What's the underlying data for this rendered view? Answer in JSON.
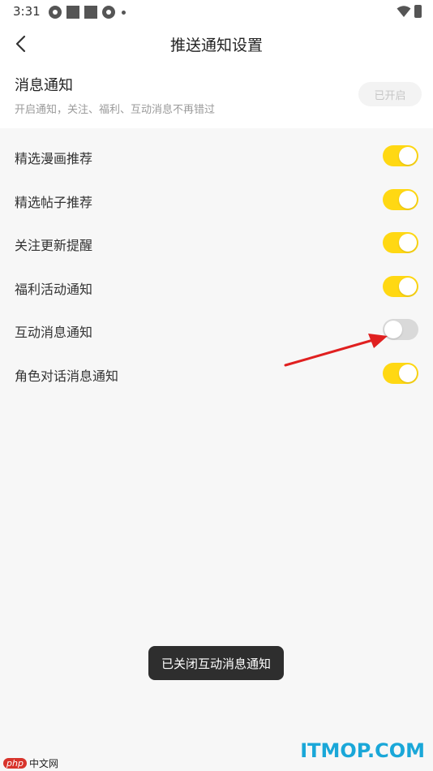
{
  "status_bar": {
    "time": "3:31"
  },
  "header": {
    "title": "推送通知设置"
  },
  "master": {
    "title": "消息通知",
    "description": "开启通知，关注、福利、互动消息不再错过",
    "badge": "已开启"
  },
  "settings": [
    {
      "label": "精选漫画推荐",
      "on": true
    },
    {
      "label": "精选帖子推荐",
      "on": true
    },
    {
      "label": "关注更新提醒",
      "on": true
    },
    {
      "label": "福利活动通知",
      "on": true
    },
    {
      "label": "互动消息通知",
      "on": false
    },
    {
      "label": "角色对话消息通知",
      "on": true
    }
  ],
  "toast": "已关闭互动消息通知",
  "watermarks": {
    "left_logo": "php",
    "left": "中文网",
    "right": "ITMOP.COM"
  },
  "colors": {
    "toggle_on": "#ffd813",
    "toggle_off": "#d9d9d9",
    "annotation_arrow": "#e02020",
    "watermark_right": "#1aa7d8"
  }
}
